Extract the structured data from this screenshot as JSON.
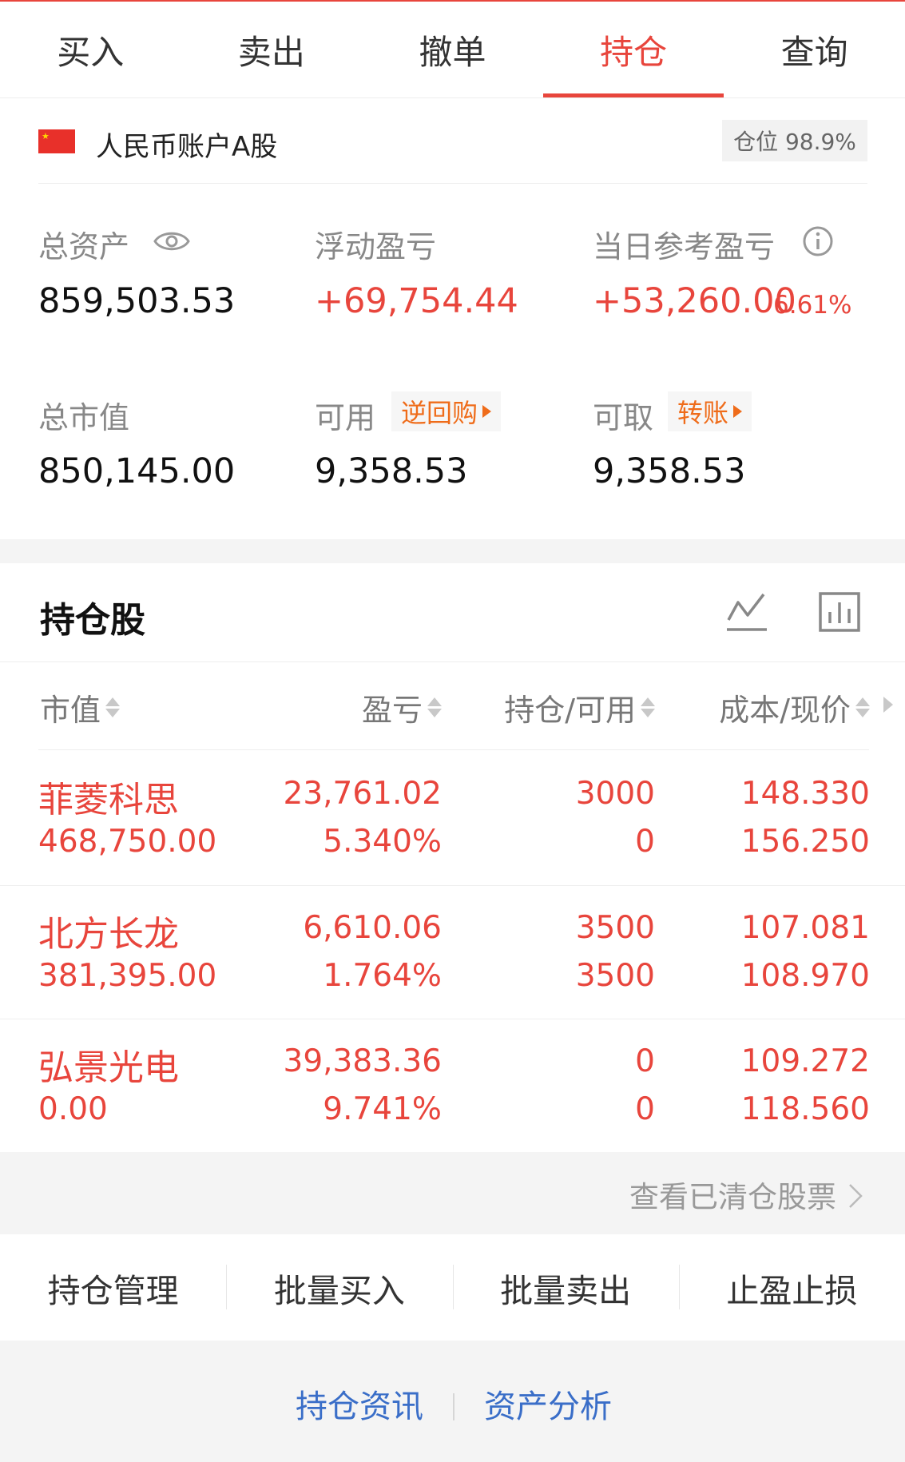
{
  "tabs": [
    {
      "label": "买入"
    },
    {
      "label": "卖出"
    },
    {
      "label": "撤单"
    },
    {
      "label": "持仓",
      "active": true
    },
    {
      "label": "查询"
    }
  ],
  "account": {
    "name": "人民币账户A股",
    "position_badge": "仓位 98.9%"
  },
  "summary": {
    "total_assets_label": "总资产",
    "total_assets": "859,503.53",
    "floating_pl_label": "浮动盈亏",
    "floating_pl": "+69,754.44",
    "daily_pl_label": "当日参考盈亏",
    "daily_pl": "+53,260.00",
    "daily_pl_pct": "6.61%",
    "market_value_label": "总市值",
    "market_value": "850,145.00",
    "available_label": "可用",
    "available_tag": "逆回购",
    "available": "9,358.53",
    "withdrawable_label": "可取",
    "withdrawable_tag": "转账",
    "withdrawable": "9,358.53"
  },
  "holdings": {
    "title": "持仓股",
    "columns": {
      "market_value": "市值",
      "pl": "盈亏",
      "hold_available": "持仓/可用",
      "cost_price": "成本/现价"
    },
    "rows": [
      {
        "name": "菲菱科思",
        "market_value": "468,750.00",
        "pl": "23,761.02",
        "pl_pct": "5.340%",
        "hold": "3000",
        "available": "0",
        "cost": "148.330",
        "price": "156.250"
      },
      {
        "name": "北方长龙",
        "market_value": "381,395.00",
        "pl": "6,610.06",
        "pl_pct": "1.764%",
        "hold": "3500",
        "available": "3500",
        "cost": "107.081",
        "price": "108.970"
      },
      {
        "name": "弘景光电",
        "market_value": "0.00",
        "pl": "39,383.36",
        "pl_pct": "9.741%",
        "hold": "0",
        "available": "0",
        "cost": "109.272",
        "price": "118.560"
      }
    ],
    "cleared_link": "查看已清仓股票"
  },
  "actions": [
    {
      "label": "持仓管理"
    },
    {
      "label": "批量买入"
    },
    {
      "label": "批量卖出"
    },
    {
      "label": "止盈止损"
    }
  ],
  "bottom_links": {
    "news": "持仓资讯",
    "analysis": "资产分析"
  },
  "colors": {
    "accent": "#e8453c",
    "tag": "#ef6c1a",
    "link": "#3a6ec8"
  },
  "icons": {
    "eye": "eye-icon",
    "info": "info-icon",
    "line_chart": "line-chart-icon",
    "bar_chart": "bar-chart-icon",
    "flag": "china-flag-icon"
  }
}
